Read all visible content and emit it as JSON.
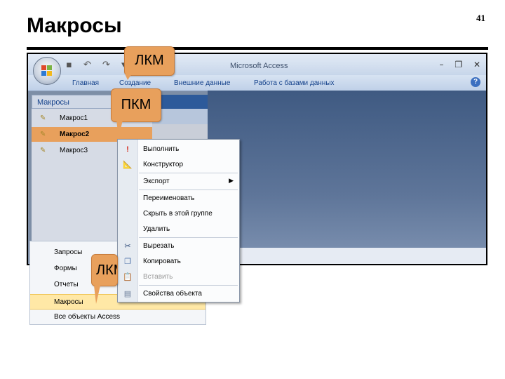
{
  "slide": {
    "title": "Макросы",
    "page_number": "41"
  },
  "window": {
    "app_title": "Microsoft Access",
    "qat_glyphs": "▪ ↶ ↷ ▾",
    "controls": {
      "minimize": "–",
      "restore": "❐",
      "close": "✕"
    },
    "tabs": [
      "Главная",
      "Создание",
      "Внешние данные",
      "Работа с базами данных"
    ],
    "help": "?"
  },
  "nav_pane": {
    "header": "Макросы",
    "items": [
      {
        "label": "Макрос1",
        "selected": false
      },
      {
        "label": "Макрос2",
        "selected": true
      },
      {
        "label": "Макрос3",
        "selected": false
      }
    ]
  },
  "category_menu": {
    "items": [
      "Запросы",
      "Формы",
      "Отчеты",
      "Макросы",
      "Все объекты Access"
    ],
    "highlighted": "Макросы"
  },
  "context_menu": {
    "items": [
      "Выполнить",
      "Конструктор",
      "Экспорт",
      "Переименовать",
      "Скрыть в этой группе",
      "Удалить",
      "Вырезать",
      "Копировать",
      "Вставить",
      "Свойства объекта"
    ],
    "disabled": [
      "Вставить"
    ]
  },
  "callouts": {
    "top": "ЛКМ",
    "middle": "ПКМ",
    "bottom": "ЛКМ"
  },
  "colors": {
    "callout": "#e8a05c",
    "selection": "#e8a05c",
    "highlight": "#ffe8a6"
  }
}
